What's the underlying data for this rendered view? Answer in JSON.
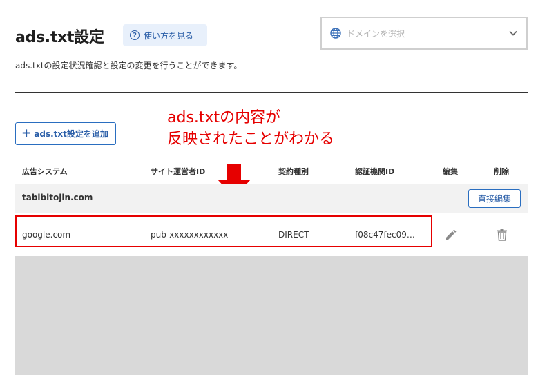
{
  "header": {
    "title": "ads.txt設定",
    "help_label": "使い方を見る",
    "subtitle": "ads.txtの設定状況確認と設定の変更を行うことができます。"
  },
  "domain_select": {
    "placeholder": "ドメインを選択",
    "icon": "globe-icon"
  },
  "annotation": {
    "line1": "ads.txtの内容が",
    "line2": "反映されたことがわかる",
    "color": "#e60000"
  },
  "toolbar": {
    "add_label": "ads.txt設定を追加"
  },
  "table": {
    "headers": [
      "広告システム",
      "サイト運営者ID",
      "契約種別",
      "認証機関ID",
      "編集",
      "削除"
    ],
    "group": {
      "name": "tabibitojin.com",
      "direct_edit_label": "直接編集"
    },
    "rows": [
      [
        "google.com",
        "pub-xxxxxxxxxxxx",
        "DIRECT",
        "f08c47fec09…"
      ]
    ]
  },
  "colors": {
    "accent": "#2a5ea8",
    "highlight": "#e60000",
    "group_bg": "#f2f2f2"
  }
}
